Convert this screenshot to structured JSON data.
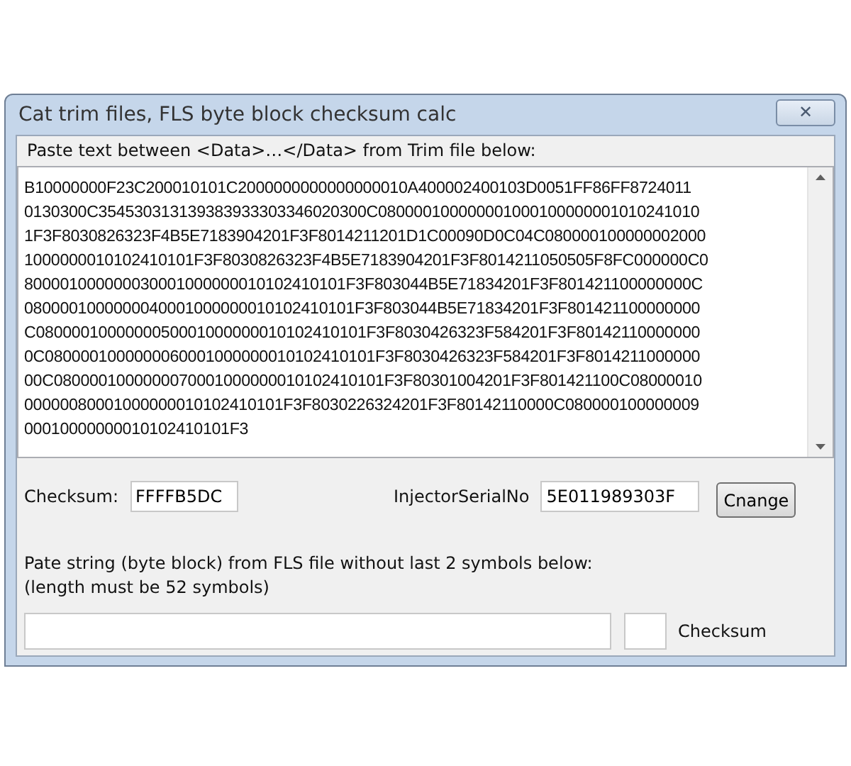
{
  "window": {
    "title": "Cat trim files, FLS byte block checksum calc",
    "close_glyph": "✕"
  },
  "paste_label": "Paste text between <Data>…</Data>  from Trim file below:",
  "trim_text": [
    "B10000000F23C200010101C2000000000000000010A400002400103D0051FF86FF8724011",
    "0130300C354530313139383933303346020300C080000100000001000100000001010241010",
    "1F3F8030826323F4B5E7183904201F3F8014211201D1C00090D0C04C080000100000002000",
    "1000000010102410101F3F8030826323F4B5E7183904201F3F8014211050505F8FC000000C0",
    "800001000000030001000000010102410101F3F803044B5E71834201F3F801421100000000C",
    "0800001000000040001000000010102410101F3F803044B5E71834201F3F801421100000000",
    "C0800001000000050001000000010102410101F3F8030426323F584201F3F80142110000000",
    "0C0800001000000060001000000010102410101F3F8030426323F584201F3F8014211000000",
    "00C0800001000000070001000000010102410101F3F80301004201F3F801421100C08000010",
    "00000080001000000010102410101F3F8030226324201F3F80142110000C080000100000009",
    "00010000000010102410101F3"
  ],
  "checksum": {
    "label": "Checksum:",
    "value": "FFFFB5DC"
  },
  "injector": {
    "label": "InjectorSerialNo",
    "value": "5E011989303F"
  },
  "change_button": "Cnange",
  "fls_label": [
    "Pate string (byte block) from FLS file without last 2 symbols below:",
    "(length must be 52 symbols)"
  ],
  "fls_checksum_label": "Checksum"
}
